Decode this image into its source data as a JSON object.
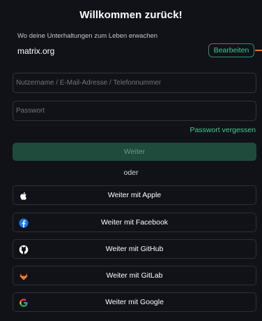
{
  "header": {
    "title": "Willkommen zurück!"
  },
  "server": {
    "tagline": "Wo deine Unterhaltungen zum Leben erwachen",
    "name": "matrix.org",
    "edit_label": "Bearbeiten"
  },
  "form": {
    "username_placeholder": "Nutzername / E-Mail-Adresse / Telefonnummer",
    "password_placeholder": "Passwort",
    "forgot_password": "Passwort vergessen",
    "continue_label": "Weiter",
    "or_label": "oder"
  },
  "sso": [
    {
      "label": "Weiter mit Apple",
      "icon": "apple-icon"
    },
    {
      "label": "Weiter mit Facebook",
      "icon": "facebook-icon"
    },
    {
      "label": "Weiter mit GitHub",
      "icon": "github-icon"
    },
    {
      "label": "Weiter mit GitLab",
      "icon": "gitlab-icon"
    },
    {
      "label": "Weiter mit Google",
      "icon": "google-icon"
    }
  ],
  "colors": {
    "background": "#101217",
    "accent": "#44c999",
    "continue_disabled": "#1f4b3c",
    "border": "#30343b"
  }
}
